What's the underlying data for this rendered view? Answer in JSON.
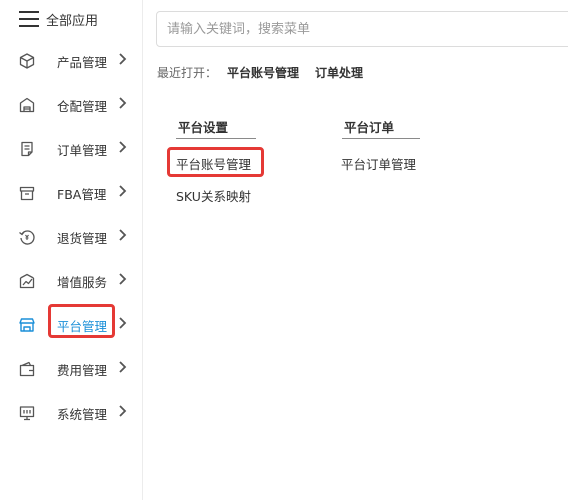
{
  "sidebar": {
    "title": "全部应用",
    "items": [
      {
        "label": "产品管理",
        "icon": "cube-icon"
      },
      {
        "label": "仓配管理",
        "icon": "warehouse-icon"
      },
      {
        "label": "订单管理",
        "icon": "document-icon"
      },
      {
        "label": "FBA管理",
        "icon": "box-icon"
      },
      {
        "label": "退货管理",
        "icon": "return-icon"
      },
      {
        "label": "增值服务",
        "icon": "chart-icon"
      },
      {
        "label": "平台管理",
        "icon": "store-icon",
        "active": true
      },
      {
        "label": "费用管理",
        "icon": "wallet-icon"
      },
      {
        "label": "系统管理",
        "icon": "monitor-icon"
      }
    ]
  },
  "search": {
    "placeholder": "请输入关键词，搜索菜单"
  },
  "recent": {
    "label": "最近打开：",
    "links": [
      "平台账号管理",
      "订单处理"
    ]
  },
  "columns": [
    {
      "heading": "平台设置",
      "items": [
        "平台账号管理",
        "SKU关系映射"
      ]
    },
    {
      "heading": "平台订单",
      "items": [
        "平台订单管理"
      ]
    }
  ],
  "colors": {
    "active": "#1a8fd8",
    "highlight_box": "#e53935"
  }
}
